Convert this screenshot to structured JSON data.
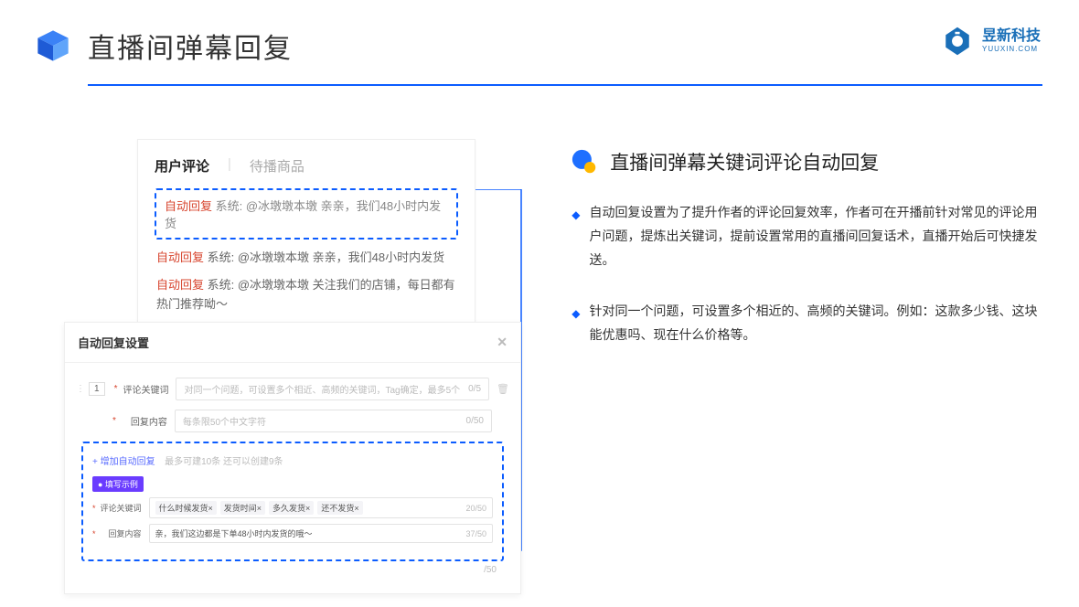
{
  "header": {
    "title": "直播间弹幕回复",
    "brand_cn": "昱新科技",
    "brand_en": "YUUXIN.COM"
  },
  "card": {
    "tab_active": "用户评论",
    "tab_inactive": "待播商品",
    "hl_tag": "自动回复",
    "hl_sys": "系统: @冰墩墩本墩 亲亲，我们48小时内发货",
    "line2_tag": "自动回复",
    "line2": "系统: @冰墩墩本墩 亲亲，我们48小时内发货",
    "line3_tag": "自动回复",
    "line3": "系统: @冰墩墩本墩 关注我们的店铺，每日都有热门推荐呦～"
  },
  "settings": {
    "title": "自动回复设置",
    "idx": "1",
    "lbl_keyword": "评论关键词",
    "ph_keyword": "对同一个问题，可设置多个相近、高频的关键词，Tag确定，最多5个",
    "cnt_keyword": "0/5",
    "lbl_content": "回复内容",
    "ph_content": "每条限50个中文字符",
    "cnt_content": "0/50",
    "add_link": "+ 增加自动回复",
    "add_hint": "最多可建10条 还可以创建9条",
    "example_badge": "● 填写示例",
    "ex_kw_label": "评论关键词",
    "tags": [
      "什么时候发货×",
      "发货时间×",
      "多久发货×",
      "还不发货×"
    ],
    "ex_kw_cnt": "20/50",
    "ex_ct_label": "回复内容",
    "ex_ct_text": "亲，我们这边都是下单48小时内发货的哦～",
    "ex_ct_cnt": "37/50",
    "outer_cnt": "/50"
  },
  "right": {
    "section_title": "直播间弹幕关键词评论自动回复",
    "b1": "自动回复设置为了提升作者的评论回复效率，作者可在开播前针对常见的评论用户问题，提炼出关键词，提前设置常用的直播间回复话术，直播开始后可快捷发送。",
    "b2": "针对同一个问题，可设置多个相近的、高频的关键词。例如：这款多少钱、这块能优惠吗、现在什么价格等。"
  }
}
